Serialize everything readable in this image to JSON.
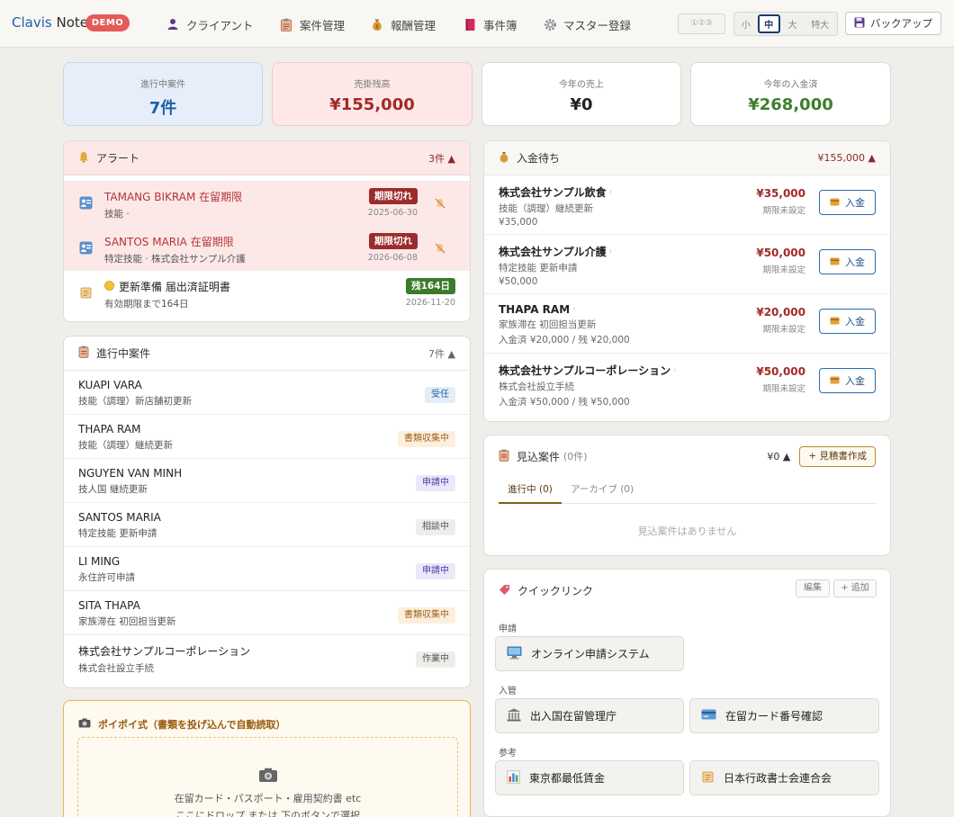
{
  "brand": {
    "name_a": "Clavis",
    "name_b": " Note",
    "badge": "DEMO"
  },
  "nav": [
    {
      "label": "クライアント",
      "icon": "person-icon"
    },
    {
      "label": "案件管理",
      "icon": "clipboard-icon"
    },
    {
      "label": "報酬管理",
      "icon": "money-bag-icon"
    },
    {
      "label": "事件簿",
      "icon": "book-icon"
    },
    {
      "label": "マスター登録",
      "icon": "gear-icon"
    }
  ],
  "toolbar": {
    "numbering": "①②③",
    "sizes": [
      "小",
      "中",
      "大",
      "特大"
    ],
    "selected_size": "中",
    "backup_label": "バックアップ"
  },
  "stats": [
    {
      "label": "進行中案件",
      "value": "7件"
    },
    {
      "label": "売掛残高",
      "value": "¥155,000"
    },
    {
      "label": "今年の売上",
      "value": "¥0"
    },
    {
      "label": "今年の入金済",
      "value": "¥268,000"
    }
  ],
  "alerts": {
    "title": "アラート",
    "count": "3件 ▲",
    "items": [
      {
        "name": "TAMANG BIKRAM 在留期限",
        "sub": "技能 ·",
        "badge": "期限切れ",
        "date": "2025-06-30"
      },
      {
        "name": "SANTOS MARIA 在留期限",
        "sub": "特定技能 · 株式会社サンプル介護",
        "badge": "期限切れ",
        "date": "2026-06-08"
      },
      {
        "name": "更新準備 届出済証明書",
        "sub": "有効期限まで164日",
        "badge": "残164日",
        "date": "2026-11-20"
      }
    ]
  },
  "cases": {
    "title": "進行中案件",
    "count": "7件 ▲",
    "items": [
      {
        "name": "KUAPI VARA",
        "sub": "技能（調理）新店舗初更新",
        "status": "受任"
      },
      {
        "name": "THAPA RAM",
        "sub": "技能（調理）継続更新",
        "status": "書類収集中"
      },
      {
        "name": "NGUYEN VAN MINH",
        "sub": "技人国 継続更新",
        "status": "申請中"
      },
      {
        "name": "SANTOS MARIA",
        "sub": "特定技能 更新申請",
        "status": "相談中"
      },
      {
        "name": "LI MING",
        "sub": "永住許可申請",
        "status": "申請中"
      },
      {
        "name": "SITA THAPA",
        "sub": "家族滞在 初回担当更新",
        "status": "書類収集中"
      },
      {
        "name": "株式会社サンプルコーポレーション",
        "sub": "株式会社設立手続",
        "status": "作業中"
      }
    ]
  },
  "dropzone": {
    "title": "ポイポイ式（書類を投げ込んで自動読取）",
    "line1": "在留カード・パスポート・雇用契約書 etc",
    "line2": "ここにドロップ または 下のボタンで選択"
  },
  "payments": {
    "title": "入金待ち",
    "total": "¥155,000 ▲",
    "button_label": "入金",
    "items": [
      {
        "name": "株式会社サンプル飲食",
        "sub1": "技能（調理）継続更新",
        "sub2": "¥35,000",
        "amount": "¥35,000",
        "due": "期限未設定"
      },
      {
        "name": "株式会社サンプル介護",
        "sub1": "特定技能 更新申請",
        "sub2": "¥50,000",
        "amount": "¥50,000",
        "due": "期限未設定"
      },
      {
        "name": "THAPA RAM",
        "sub1": "家族滞在 初回担当更新",
        "sub2": "入金済 ¥20,000 / 残 ¥20,000",
        "amount": "¥20,000",
        "due": "期限未設定"
      },
      {
        "name": "株式会社サンプルコーポレーション",
        "sub1": "株式会社設立手続",
        "sub2": "入金済 ¥50,000 / 残 ¥50,000",
        "amount": "¥50,000",
        "due": "期限未設定"
      }
    ]
  },
  "prospects": {
    "title": "見込案件",
    "count": "(0件)",
    "total": "¥0 ▲",
    "create_label": "+ 見積書作成",
    "tabs": [
      "進行中 (0)",
      "アーカイブ (0)"
    ],
    "empty": "見込案件はありません"
  },
  "quicklinks": {
    "title": "クイックリンク",
    "edit_label": "編集",
    "add_label": "+ 追加",
    "sections": [
      {
        "label": "申請",
        "links": [
          {
            "label": "オンライン申請システム",
            "icon": "computer-icon"
          }
        ]
      },
      {
        "label": "入管",
        "links": [
          {
            "label": "出入国在留管理庁",
            "icon": "government-building-icon"
          },
          {
            "label": "在留カード番号確認",
            "icon": "card-icon"
          }
        ]
      },
      {
        "label": "参考",
        "links": [
          {
            "label": "東京都最低賃金",
            "icon": "bar-chart-icon"
          },
          {
            "label": "日本行政書士会連合会",
            "icon": "scroll-icon"
          }
        ]
      }
    ]
  },
  "colors": {
    "brand_blue": "#1f5fa8",
    "demo_red": "#e55a5a",
    "expired_red": "#9b2c2c",
    "remaining_green": "#3c7a2a",
    "alert_row_bg": "#fde8e8",
    "stat_blue_bg": "#e6eff9",
    "stat_red_bg": "#fde8e7",
    "received_green": "#3f7d2e"
  }
}
